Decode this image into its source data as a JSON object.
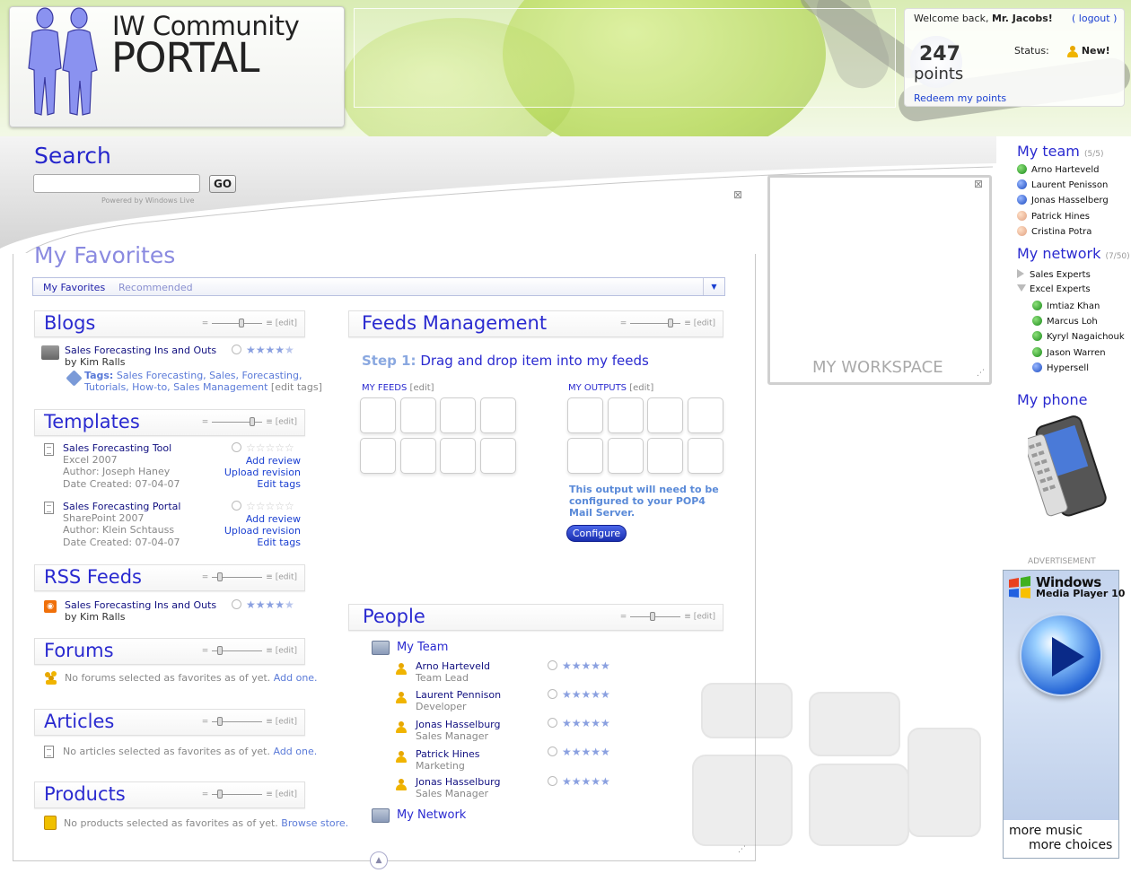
{
  "header": {
    "logo_line1": "IW Community",
    "logo_line2": "PORTAL",
    "welcome_prefix": "Welcome back,",
    "welcome_name": "Mr. Jacobs!",
    "logout": "( logout )",
    "points_value": "247",
    "points_label": "points",
    "status_label": "Status:",
    "status_value": "New!",
    "redeem": "Redeem my points"
  },
  "search": {
    "title": "Search",
    "placeholder": "",
    "go": "GO",
    "powered": "Powered by Windows Live"
  },
  "favorites": {
    "title": "My Favorites",
    "tabs": [
      "My Favorites",
      "Recommended"
    ]
  },
  "edit": "[edit]",
  "blogs": {
    "title": "Blogs",
    "item_title": "Sales Forecasting Ins and Outs",
    "item_by": "by Kim Ralls",
    "tags_label": "Tags:",
    "tags_line1": "Sales Forecasting, Sales, Forecasting,",
    "tags_line2": "Tutorials, How-to, Sales Management",
    "edit_tags": "[edit tags]",
    "rating": 4.5
  },
  "templates": {
    "title": "Templates",
    "items": [
      {
        "title": "Sales Forecasting Tool",
        "app": "Excel 2007",
        "author": "Author: Joseph Haney",
        "date": "Date Created: 07-04-07",
        "a1": "Add review",
        "a2": "Upload revision",
        "a3": "Edit tags",
        "rating": 0
      },
      {
        "title": "Sales Forecasting Portal",
        "app": "SharePoint 2007",
        "author": "Author: Klein Schtauss",
        "date": "Date Created: 07-04-07",
        "a1": "Add review",
        "a2": "Upload revision",
        "a3": "Edit tags",
        "rating": 0
      }
    ]
  },
  "rss": {
    "title": "RSS Feeds",
    "item_title": "Sales Forecasting Ins and Outs",
    "item_by": "by Kim Ralls",
    "rating": 4.5
  },
  "forums": {
    "title": "Forums",
    "text": "No forums selected as favorites as of yet.",
    "link": "Add one."
  },
  "articles": {
    "title": "Articles",
    "text": "No articles selected as favorites as of yet.",
    "link": "Add one."
  },
  "products": {
    "title": "Products",
    "text": "No products selected as favorites as of yet.",
    "link": "Browse store."
  },
  "feeds": {
    "title": "Feeds Management",
    "step_label": "Step 1:",
    "step_text": "Drag and drop item into my feeds",
    "my_feeds": "MY FEEDS",
    "my_outputs": "MY OUTPUTS",
    "note": "This output will need to be configured to your POP4 Mail Server.",
    "configure": "Configure"
  },
  "people": {
    "title": "People",
    "team_label": "My Team",
    "network_label": "My Network",
    "members": [
      {
        "name": "Arno Harteveld",
        "role": "Team Lead",
        "rating": 5
      },
      {
        "name": "Laurent Pennison",
        "role": "Developer",
        "rating": 5
      },
      {
        "name": "Jonas Hasselburg",
        "role": "Sales Manager",
        "rating": 5
      },
      {
        "name": "Patrick Hines",
        "role": "Marketing",
        "rating": 5
      },
      {
        "name": "Jonas Hasselburg",
        "role": "Sales Manager",
        "rating": 5
      }
    ]
  },
  "workspace": {
    "label": "MY WORKSPACE"
  },
  "sidebar": {
    "team_title": "My team",
    "team_count": "(5/5)",
    "team": [
      {
        "name": "Arno Harteveld",
        "status": "online"
      },
      {
        "name": "Laurent Penisson",
        "status": "away"
      },
      {
        "name": "Jonas Hasselberg",
        "status": "busy"
      },
      {
        "name": "Patrick Hines",
        "status": "offline"
      },
      {
        "name": "Cristina Potra",
        "status": "offline"
      }
    ],
    "network_title": "My network",
    "network_count": "(7/50)",
    "groups": [
      "Sales Experts",
      "Excel Experts"
    ],
    "network": [
      {
        "name": "Imtiaz Khan",
        "status": "online"
      },
      {
        "name": "Marcus Loh",
        "status": "online"
      },
      {
        "name": "Kyryl Nagaichouk",
        "status": "online"
      },
      {
        "name": "Jason Warren",
        "status": "online"
      },
      {
        "name": "Hypersell",
        "status": "busy"
      }
    ],
    "phone_title": "My phone"
  },
  "ad": {
    "label": "ADVERTISEMENT",
    "brand": "Windows",
    "product": "Media Player 10",
    "line1": "more music",
    "line2": "more choices"
  },
  "colors": {
    "accent": "#2a2ad0",
    "link": "#1a3fd1",
    "header_bg": "#d9ecb4"
  }
}
